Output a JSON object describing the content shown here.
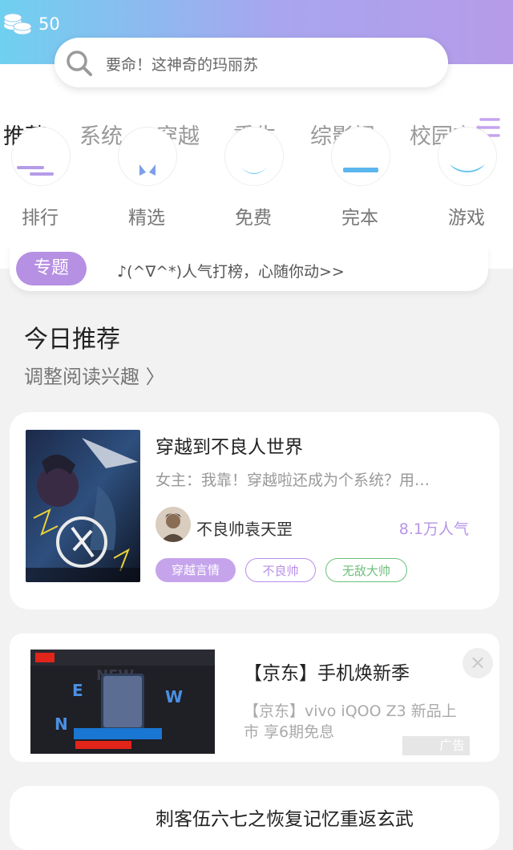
{
  "header": {
    "coin_icon": "coins-icon",
    "coin_count": "50",
    "colors": {
      "from": "#6fd0f0",
      "to": "#b69be8"
    }
  },
  "search": {
    "icon": "search-icon",
    "placeholder": "要命！这神奇的玛丽苏"
  },
  "tabs": [
    {
      "label": "推荐",
      "active": true
    },
    {
      "label": "系统"
    },
    {
      "label": "穿越"
    },
    {
      "label": "重生"
    },
    {
      "label": "综影视"
    },
    {
      "label": "校园言情"
    }
  ],
  "tabs_menu_icon": "menu-lines-icon",
  "categories": [
    {
      "label": "排行",
      "icon": "ranking-icon"
    },
    {
      "label": "精选",
      "icon": "featured-icon"
    },
    {
      "label": "免费",
      "icon": "free-icon"
    },
    {
      "label": "完本",
      "icon": "finished-icon"
    },
    {
      "label": "游戏",
      "icon": "game-icon"
    }
  ],
  "topic": {
    "badge": "专题",
    "text": "♪(^∇^*)人气打榜，心随你动>>"
  },
  "section": {
    "title": "今日推荐",
    "subtitle": "调整阅读兴趣 〉"
  },
  "book": {
    "title": "穿越到不良人世界",
    "description": "女主：我靠！穿越啦还成为个系统？用…",
    "author": "不良帅袁天罡",
    "popularity": "8.1万人气",
    "tags": [
      {
        "label": "穿越言情",
        "style": "filled",
        "color": "#c6a4ec"
      },
      {
        "label": "不良帅",
        "style": "outline",
        "color": "#b98fe8"
      },
      {
        "label": "无敌大帅",
        "style": "outline",
        "color": "#6cc07a"
      }
    ]
  },
  "ad": {
    "title": "【京东】手机焕新季",
    "description": "【京东】vivo iQOO Z3 新品上市 享6期免息",
    "badge": "广告",
    "close_icon": "close-icon"
  },
  "next_book": {
    "title": "刺客伍六七之恢复记忆重返玄武"
  }
}
